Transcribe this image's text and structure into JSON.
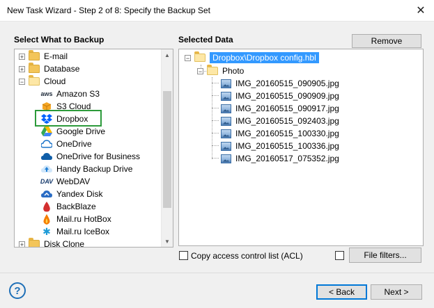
{
  "window": {
    "title": "New Task Wizard - Step 2 of 8: Specify the Backup Set",
    "close_glyph": "✕"
  },
  "left_panel": {
    "label": "Select What to Backup",
    "items": [
      {
        "label": "E-mail",
        "kind": "folder",
        "expander": "+"
      },
      {
        "label": "Database",
        "kind": "folder",
        "expander": "+"
      },
      {
        "label": "Cloud",
        "kind": "folder",
        "expander": "−"
      },
      {
        "label": "Amazon S3",
        "kind": "service",
        "icon": "amazon-s3-icon"
      },
      {
        "label": "S3 Cloud",
        "kind": "service",
        "icon": "s3-cloud-icon"
      },
      {
        "label": "Dropbox",
        "kind": "service",
        "icon": "dropbox-icon"
      },
      {
        "label": "Google Drive",
        "kind": "service",
        "icon": "google-drive-icon"
      },
      {
        "label": "OneDrive",
        "kind": "service",
        "icon": "onedrive-icon"
      },
      {
        "label": "OneDrive for Business",
        "kind": "service",
        "icon": "onedrive-business-icon"
      },
      {
        "label": "Handy Backup Drive",
        "kind": "service",
        "icon": "handy-backup-drive-icon"
      },
      {
        "label": "WebDAV",
        "kind": "service",
        "icon": "webdav-icon"
      },
      {
        "label": "Yandex Disk",
        "kind": "service",
        "icon": "yandex-disk-icon"
      },
      {
        "label": "BackBlaze",
        "kind": "service",
        "icon": "backblaze-icon"
      },
      {
        "label": "Mail.ru HotBox",
        "kind": "service",
        "icon": "mailru-hotbox-icon"
      },
      {
        "label": "Mail.ru IceBox",
        "kind": "service",
        "icon": "mailru-icebox-icon"
      },
      {
        "label": "Disk Clone",
        "kind": "folder",
        "expander": "+"
      }
    ],
    "aws_text": "aws",
    "dav_text": "DAV",
    "highlight_color": "#2c9a3a"
  },
  "right_panel": {
    "label": "Selected Data",
    "remove_label": "Remove",
    "root": "Dropbox\\Dropbox config.hbl",
    "folder": "Photo",
    "files": [
      "IMG_20160515_090905.jpg",
      "IMG_20160515_090909.jpg",
      "IMG_20160515_090917.jpg",
      "IMG_20160515_092403.jpg",
      "IMG_20160515_100330.jpg",
      "IMG_20160515_100336.jpg",
      "IMG_20160517_075352.jpg"
    ]
  },
  "options": {
    "acl_label": "Copy access control list (ACL)",
    "file_filters_label": "File filters..."
  },
  "footer": {
    "help_glyph": "?",
    "back_label": "< Back",
    "next_label": "Next >"
  },
  "colors": {
    "selection": "#3399ff",
    "accent": "#0078d7"
  }
}
